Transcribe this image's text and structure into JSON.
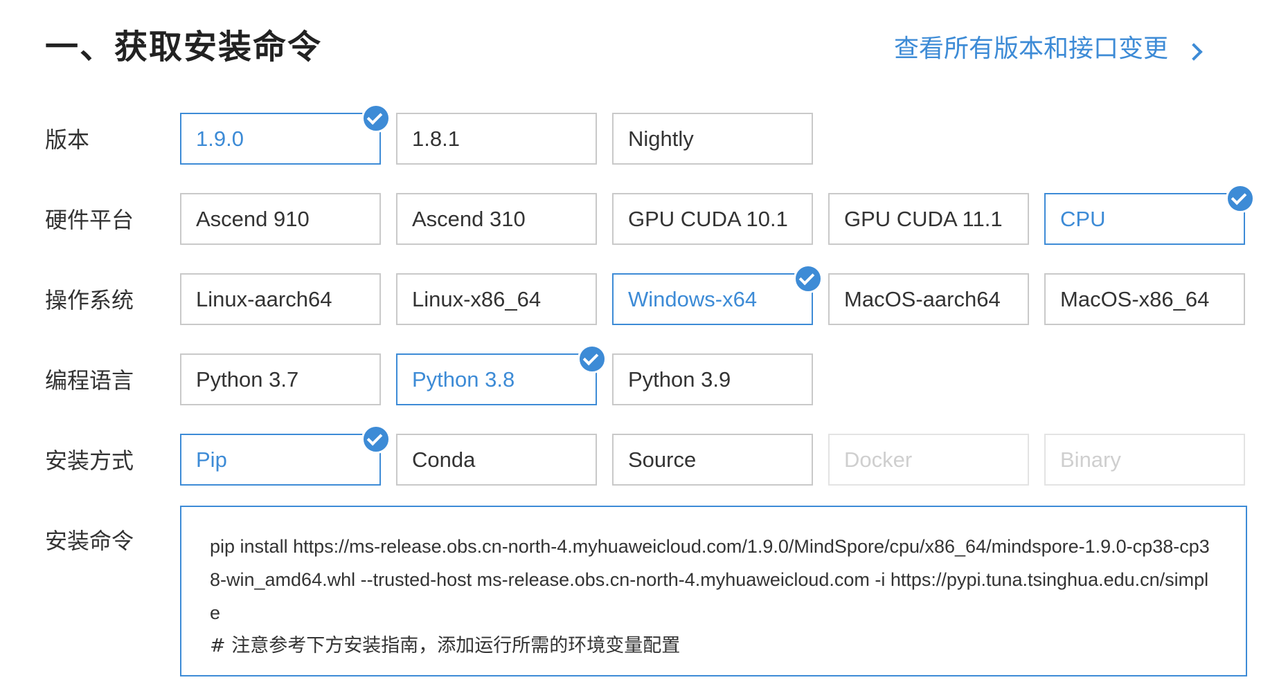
{
  "header": {
    "title": "一、获取安装命令",
    "changelog_link": "查看所有版本和接口变更"
  },
  "rows": {
    "version": {
      "label": "版本",
      "options": [
        "1.9.0",
        "1.8.1",
        "Nightly"
      ],
      "selected": "1.9.0"
    },
    "hardware": {
      "label": "硬件平台",
      "options": [
        "Ascend 910",
        "Ascend 310",
        "GPU CUDA 10.1",
        "GPU CUDA 11.1",
        "CPU"
      ],
      "selected": "CPU"
    },
    "os": {
      "label": "操作系统",
      "options": [
        "Linux-aarch64",
        "Linux-x86_64",
        "Windows-x64",
        "MacOS-aarch64",
        "MacOS-x86_64"
      ],
      "selected": "Windows-x64"
    },
    "language": {
      "label": "编程语言",
      "options": [
        "Python 3.7",
        "Python 3.8",
        "Python 3.9"
      ],
      "selected": "Python 3.8"
    },
    "install_method": {
      "label": "安装方式",
      "options": [
        "Pip",
        "Conda",
        "Source",
        "Docker",
        "Binary"
      ],
      "selected": "Pip",
      "disabled": [
        "Docker",
        "Binary"
      ]
    }
  },
  "command": {
    "label": "安装命令",
    "text": "pip install https://ms-release.obs.cn-north-4.myhuaweicloud.com/1.9.0/MindSpore/cpu/x86_64/mindspore-1.9.0-cp38-cp38-win_amd64.whl --trusted-host ms-release.obs.cn-north-4.myhuaweicloud.com -i https://pypi.tuna.tsinghua.edu.cn/simple",
    "note": "# 注意参考下方安装指南，添加运行所需的环境变量配置"
  },
  "colors": {
    "accent": "#3d8bd6",
    "border": "#c9c9c9",
    "disabled_text": "#cfcfcf",
    "text": "#333333"
  },
  "icons": {
    "selected_marker": "check-circle-icon",
    "link_arrow": "chevron-right-icon"
  }
}
